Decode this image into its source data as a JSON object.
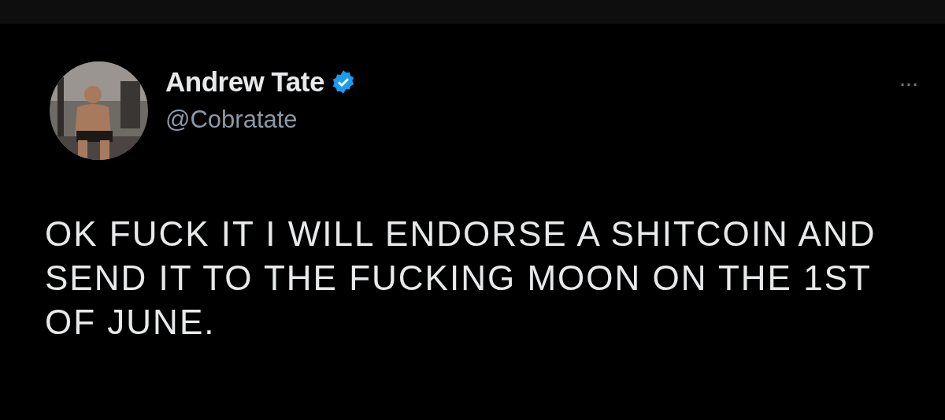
{
  "author": {
    "name": "Andrew Tate",
    "verified": true,
    "handle": "@Cobratate"
  },
  "more_menu": {
    "label": "···"
  },
  "tweet": {
    "text": "OK FUCK IT I WILL ENDORSE A SHITCOIN AND SEND IT TO THE FUCKING MOON ON THE 1ST OF JUNE."
  }
}
